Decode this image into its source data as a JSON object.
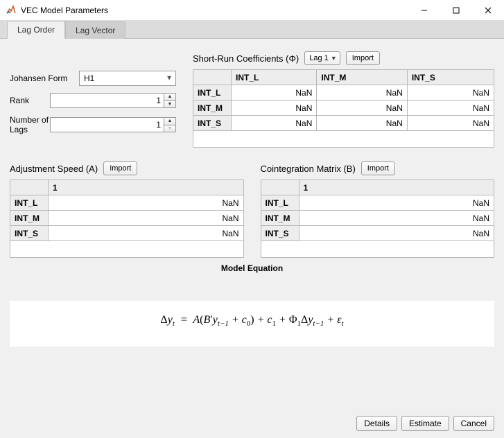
{
  "window": {
    "title": "VEC Model Parameters"
  },
  "tabs": [
    {
      "label": "Lag Order",
      "active": true
    },
    {
      "label": "Lag Vector",
      "active": false
    }
  ],
  "form": {
    "johansen_label": "Johansen Form",
    "johansen_value": "H1",
    "rank_label": "Rank",
    "rank_value": "1",
    "lags_label": "Number of Lags",
    "lags_value": "1"
  },
  "shortrun": {
    "title": "Short-Run  Coefficients  (Φ)",
    "lag_selector": "Lag 1",
    "import_label": "Import",
    "columns": [
      "INT_L",
      "INT_M",
      "INT_S"
    ],
    "rows": [
      {
        "name": "INT_L",
        "cells": [
          "NaN",
          "NaN",
          "NaN"
        ]
      },
      {
        "name": "INT_M",
        "cells": [
          "NaN",
          "NaN",
          "NaN"
        ]
      },
      {
        "name": "INT_S",
        "cells": [
          "NaN",
          "NaN",
          "NaN"
        ]
      }
    ]
  },
  "adjustment": {
    "title": "Adjustment  Speed  (A)",
    "import_label": "Import",
    "columns": [
      "1"
    ],
    "rows": [
      {
        "name": "INT_L",
        "cells": [
          "NaN"
        ]
      },
      {
        "name": "INT_M",
        "cells": [
          "NaN"
        ]
      },
      {
        "name": "INT_S",
        "cells": [
          "NaN"
        ]
      }
    ]
  },
  "coint": {
    "title": "Cointegration  Matrix  (B)",
    "import_label": "Import",
    "columns": [
      "1"
    ],
    "rows": [
      {
        "name": "INT_L",
        "cells": [
          "NaN"
        ]
      },
      {
        "name": "INT_M",
        "cells": [
          "NaN"
        ]
      },
      {
        "name": "INT_S",
        "cells": [
          "NaN"
        ]
      }
    ]
  },
  "equation": {
    "title": "Model Equation"
  },
  "footer": {
    "details": "Details",
    "estimate": "Estimate",
    "cancel": "Cancel"
  }
}
